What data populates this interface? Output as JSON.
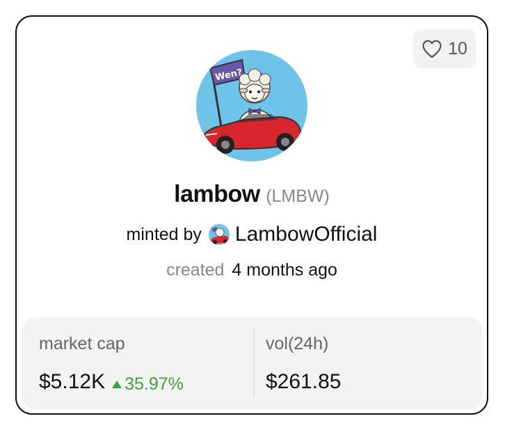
{
  "like": {
    "count": "10",
    "icon": "heart-outline-icon"
  },
  "token": {
    "name": "lambow",
    "symbol": "(LMBW)",
    "flag_text": "Wen?"
  },
  "creator": {
    "minted_label": "minted by",
    "name": "LambowOfficial"
  },
  "created": {
    "label": "created",
    "value": "4 months ago"
  },
  "stats": {
    "market_cap": {
      "label": "market cap",
      "value": "$5.12K",
      "change": "35.97%",
      "change_icon": "triangle-up-icon"
    },
    "volume": {
      "label": "vol(24h)",
      "value": "$261.85"
    }
  },
  "colors": {
    "accent_green": "#3aa53a",
    "border": "#111111",
    "stats_bg": "#f3f3f3",
    "avatar_bg": "#6ec3ea",
    "car_red": "#d8262c",
    "flag_purple": "#6b56a6"
  }
}
